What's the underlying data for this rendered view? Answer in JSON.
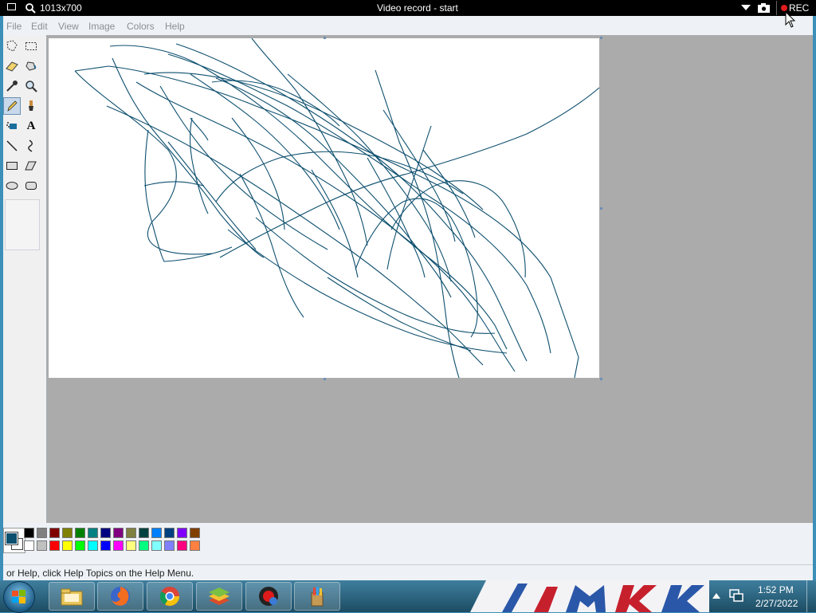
{
  "recorder": {
    "size_label": "1013x700",
    "title": "Video record - start",
    "rec_label": "REC"
  },
  "menu": {
    "items": [
      {
        "label": "File"
      },
      {
        "label": "Edit"
      },
      {
        "label": "View"
      },
      {
        "label": "Image"
      },
      {
        "label": "Colors"
      },
      {
        "label": "Help"
      }
    ]
  },
  "tools": [
    {
      "name": "free-select-icon"
    },
    {
      "name": "rect-select-icon"
    },
    {
      "name": "eraser-icon"
    },
    {
      "name": "fill-bucket-icon"
    },
    {
      "name": "color-picker-icon"
    },
    {
      "name": "magnifier-icon"
    },
    {
      "name": "pencil-icon",
      "selected": true
    },
    {
      "name": "brush-icon"
    },
    {
      "name": "airbrush-icon"
    },
    {
      "name": "text-icon"
    },
    {
      "name": "line-icon"
    },
    {
      "name": "curve-icon"
    },
    {
      "name": "rectangle-icon"
    },
    {
      "name": "polygon-icon"
    },
    {
      "name": "ellipse-icon"
    },
    {
      "name": "rounded-rect-icon"
    }
  ],
  "palette": {
    "foreground": "#0d4f6e",
    "background": "#ffffff",
    "row1": [
      "#000000",
      "#808080",
      "#800000",
      "#808000",
      "#008000",
      "#008080",
      "#000080",
      "#800080",
      "#808040",
      "#004040",
      "#0080ff",
      "#004080",
      "#8000ff",
      "#804000"
    ],
    "row2": [
      "#ffffff",
      "#c0c0c0",
      "#ff0000",
      "#ffff00",
      "#00ff00",
      "#00ffff",
      "#0000ff",
      "#ff00ff",
      "#ffff80",
      "#00ff80",
      "#80ffff",
      "#8080ff",
      "#ff0080",
      "#ff8040"
    ]
  },
  "status": {
    "text": "or Help, click Help Topics on the Help Menu."
  },
  "stroke_color": "#0d4f6e",
  "clock": {
    "time": "1:52 PM",
    "date": "2/27/2022"
  }
}
